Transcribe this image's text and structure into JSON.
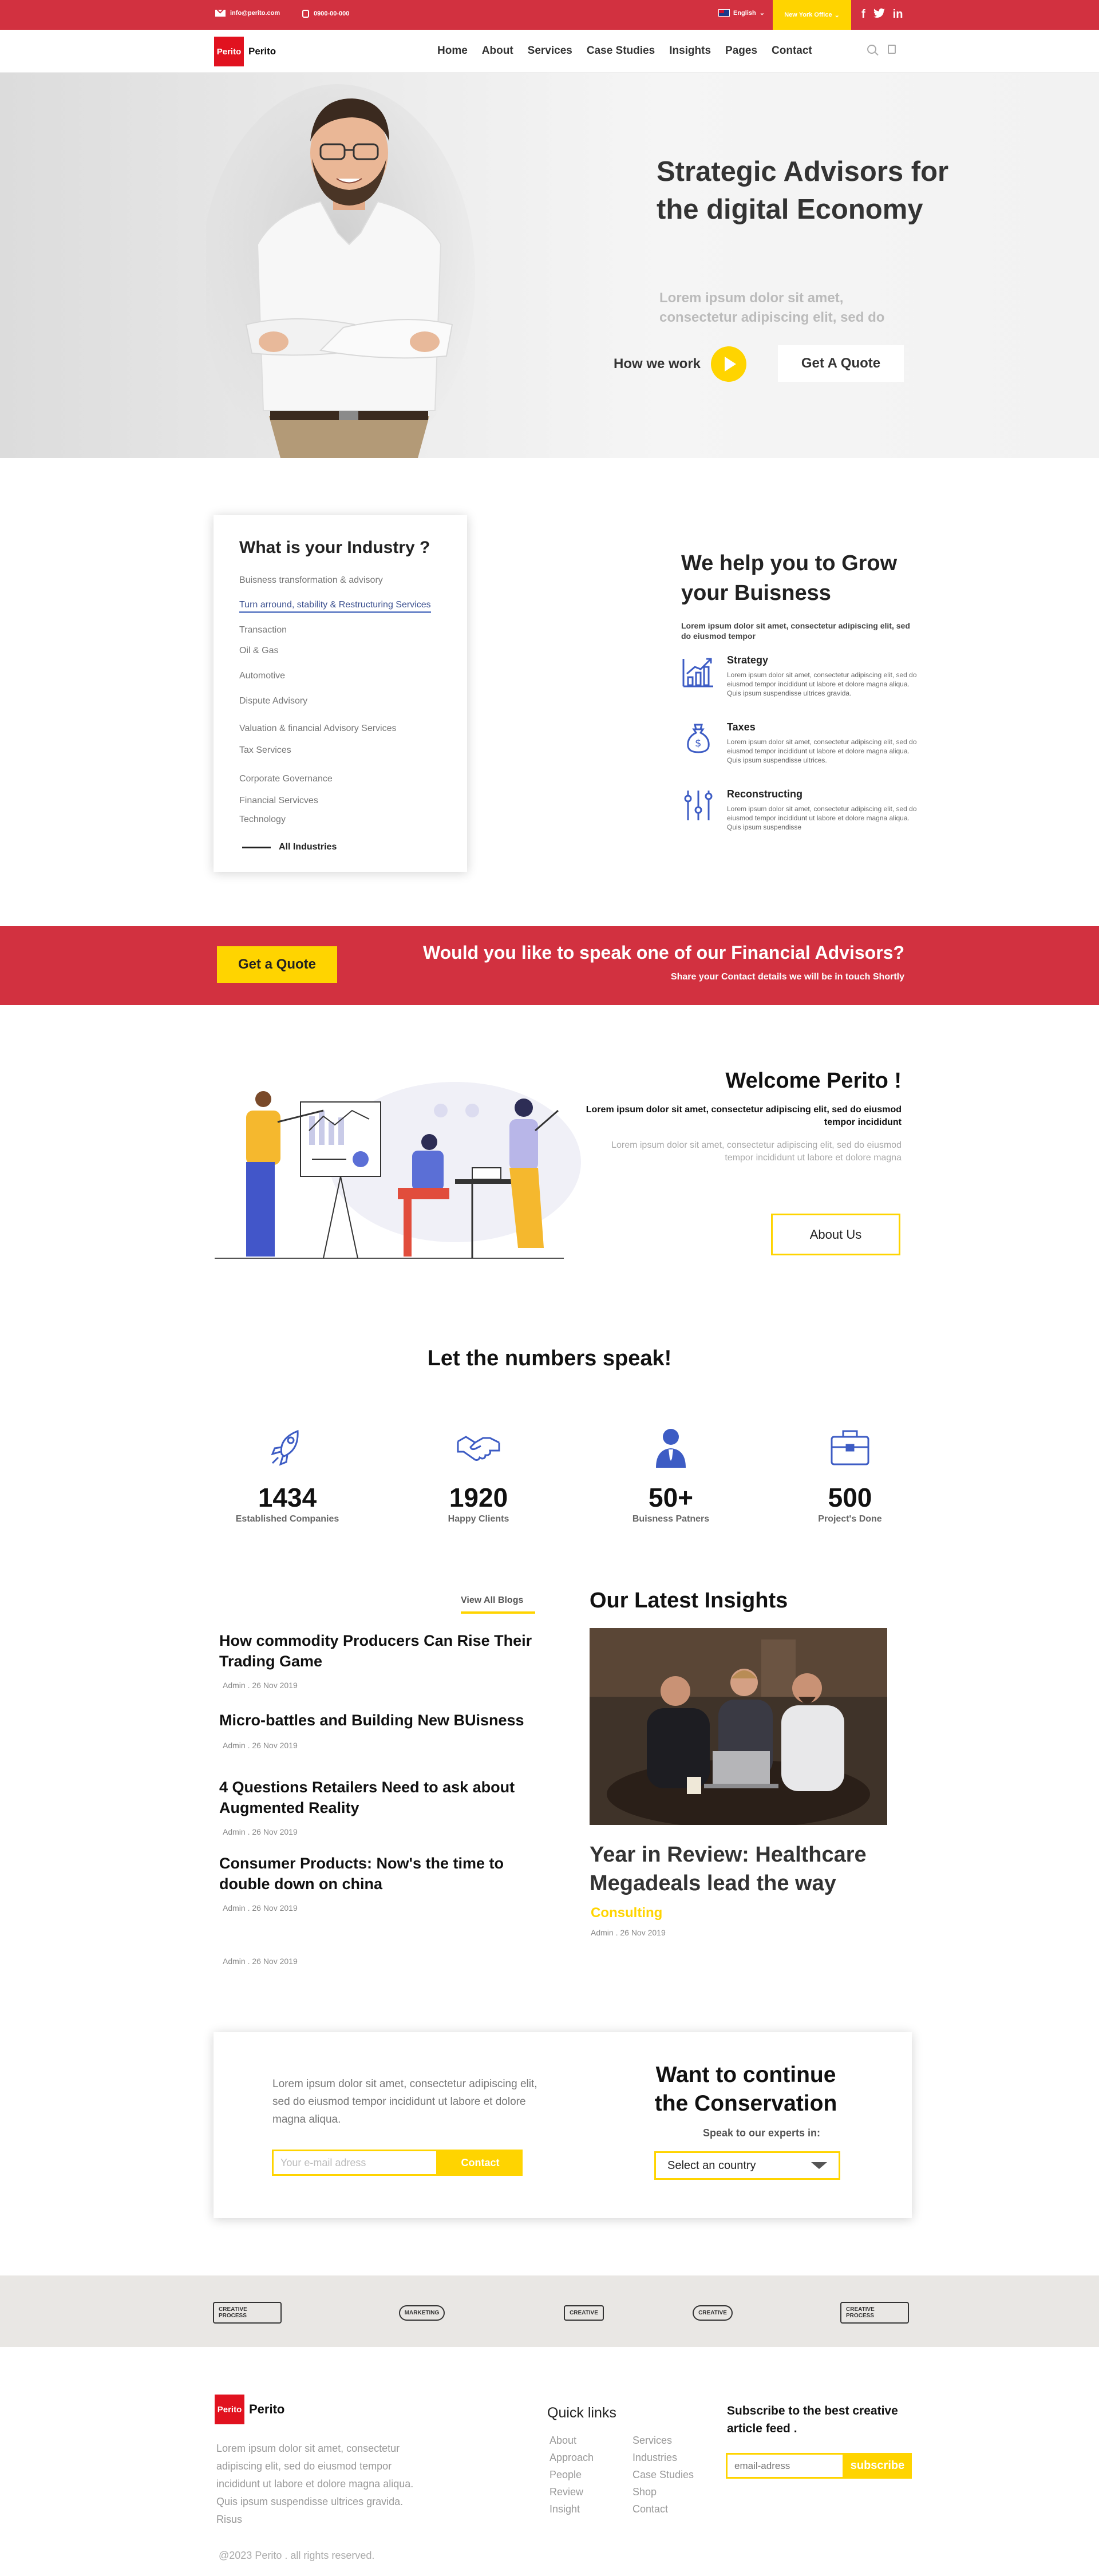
{
  "topbar": {
    "email": "info@perito.com",
    "phone": "0900-00-000",
    "language": "English",
    "office": "New York Office",
    "social": [
      "f",
      "t",
      "in"
    ]
  },
  "nav": {
    "logo_mark": "Perito",
    "logo_text": "Perito",
    "items": [
      "Home",
      "About",
      "Services",
      "Case Studies",
      "Insights",
      "Pages",
      "Contact"
    ]
  },
  "hero": {
    "title": "Strategic Advisors for the digital Economy",
    "subtitle": "Lorem ipsum dolor sit amet, consectetur adipiscing elit, sed do",
    "how_label": "How we work",
    "quote_label": "Get A Quote"
  },
  "industry": {
    "title": "What is your Industry ?",
    "items": [
      "Buisness transformation & advisory",
      "Turn arround, stability & Restructuring Services",
      "Transaction",
      "Oil & Gas",
      "Automotive",
      "Dispute Advisory",
      "Valuation & financial Advisory Services",
      "Tax Services",
      "Corporate Governance",
      "Financial Servicves",
      "Technology"
    ],
    "all_label": "All Industries"
  },
  "grow": {
    "title": "We help you to Grow your Buisness",
    "lead": "Lorem ipsum dolor sit amet, consectetur adipiscing elit, sed do eiusmod tempor",
    "features": [
      {
        "title": "Strategy",
        "icon": "growth-chart-icon",
        "text": "Lorem ipsum dolor sit amet, consectetur adipiscing elit, sed do eiusmod tempor incididunt ut labore et dolore magna aliqua. Quis ipsum suspendisse ultrices gravida."
      },
      {
        "title": "Taxes",
        "icon": "money-bag-icon",
        "text": "Lorem ipsum dolor sit amet, consectetur adipiscing elit, sed do eiusmod tempor incididunt ut labore et dolore magna aliqua. Quis ipsum suspendisse ultrices."
      },
      {
        "title": "Reconstructing",
        "icon": "sliders-icon",
        "text": "Lorem ipsum dolor sit amet, consectetur adipiscing elit, sed do eiusmod tempor incididunt ut labore et dolore magna aliqua. Quis ipsum suspendisse"
      }
    ]
  },
  "banner": {
    "button": "Get a Quote",
    "title": "Would you like to speak one of our Financial Advisors?",
    "subtitle": "Share your Contact details we will be in touch Shortly"
  },
  "welcome": {
    "title": "Welcome Perito !",
    "p1": "Lorem ipsum dolor sit amet, consectetur adipiscing elit, sed do eiusmod tempor incididunt",
    "p2": "Lorem ipsum dolor sit amet, consectetur adipiscing elit, sed do eiusmod tempor incididunt ut labore et dolore magna",
    "button": "About Us"
  },
  "numbers": {
    "title": "Let the numbers speak!",
    "stats": [
      {
        "value": "1434",
        "label": "Established Companies",
        "icon": "rocket-icon"
      },
      {
        "value": "1920",
        "label": "Happy Clients",
        "icon": "handshake-icon"
      },
      {
        "value": "50+",
        "label": "Buisness Patners",
        "icon": "businessman-icon"
      },
      {
        "value": "500",
        "label": "Project's Done",
        "icon": "briefcase-icon"
      }
    ]
  },
  "blogs": {
    "view_all": "View All Blogs",
    "posts": [
      {
        "title": "How commodity Producers Can Rise Their Trading Game",
        "meta": "Admin . 26 Nov 2019"
      },
      {
        "title": "Micro-battles and Building New BUisness",
        "meta": "Admin . 26 Nov 2019"
      },
      {
        "title": "4 Questions Retailers Need to ask about Augmented Reality",
        "meta": "Admin . 26 Nov 2019"
      },
      {
        "title": "Consumer Products: Now's the time to double down on china",
        "meta": "Admin . 26 Nov 2019"
      }
    ],
    "extra_meta": "Admin . 26 Nov 2019"
  },
  "insights": {
    "title": "Our Latest Insights",
    "headline": "Year in Review: Healthcare Megadeals lead the way",
    "tag": "Consulting",
    "meta": "Admin . 26 Nov 2019"
  },
  "conversation": {
    "lorem": "Lorem ipsum dolor sit amet, consectetur adipiscing elit, sed do eiusmod tempor incididunt ut labore et dolore magna aliqua.",
    "email_placeholder": "Your e-mail adress",
    "contact_label": "Contact",
    "title": "Want to continue the Conservation",
    "speak": "Speak to our experts in:",
    "select_value": "Select an country"
  },
  "logos": [
    "CREATIVE PROCESS",
    "MARKETING",
    "CREATIVE",
    "CREATIVE",
    "CREATIVE PROCESS"
  ],
  "footer": {
    "logo_mark": "Perito",
    "logo_text": "Perito",
    "lorem": "Lorem ipsum dolor sit amet, consectetur adipiscing elit, sed do eiusmod tempor incididunt ut labore et dolore magna aliqua. Quis ipsum suspendisse ultrices gravida. Risus",
    "quick_links_title": "Quick links",
    "links_col1": [
      "About",
      "Approach",
      "People",
      "Review",
      "Insight"
    ],
    "links_col2": [
      "Services",
      "Industries",
      "Case Studies",
      "Shop",
      "Contact"
    ],
    "subscribe_title": "Subscribe to the best creative article feed .",
    "subscribe_placeholder": "email-adress",
    "subscribe_label": "subscribe",
    "copyright": "@2023 Perito . all rights reserved."
  },
  "colors": {
    "brand_red": "#d23140",
    "accent_yellow": "#ffd400",
    "icon_blue": "#3d5cc4"
  }
}
